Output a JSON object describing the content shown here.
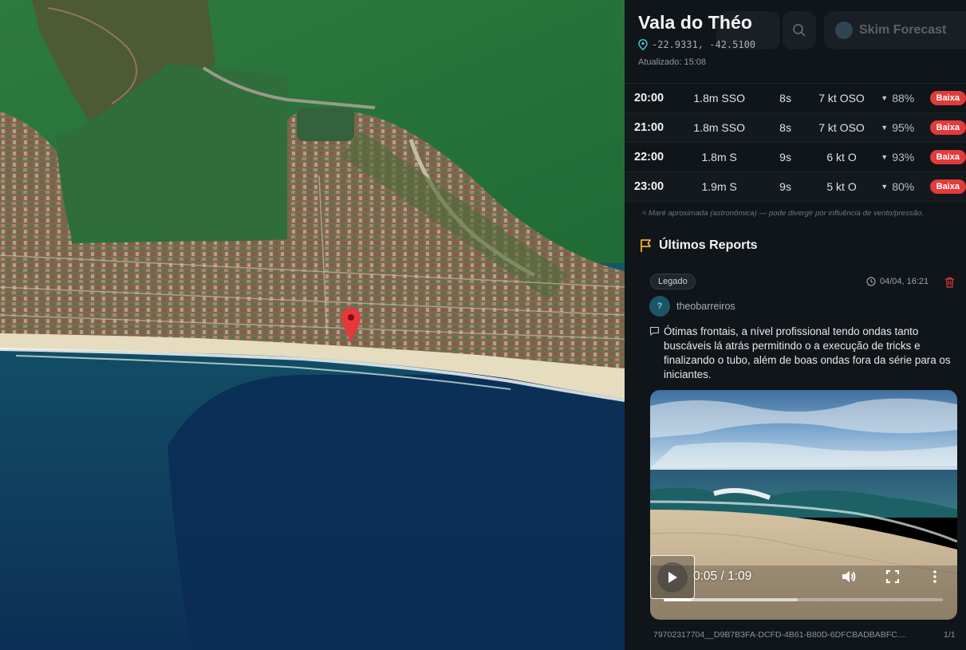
{
  "spot": {
    "name": "Vala do Théo",
    "coordinates": "-22.9331, -42.5100",
    "updated": "Atualizado: 15:08"
  },
  "header_bg": {
    "brand": "Skim Forecast"
  },
  "forecast": {
    "rows": [
      {
        "time": "20:00",
        "wave": "1.8m SSO",
        "period": "8s",
        "wind": "7 kt OSO",
        "tide": "88%",
        "rating": "Baixa"
      },
      {
        "time": "21:00",
        "wave": "1.8m SSO",
        "period": "8s",
        "wind": "7 kt OSO",
        "tide": "95%",
        "rating": "Baixa"
      },
      {
        "time": "22:00",
        "wave": "1.8m S",
        "period": "9s",
        "wind": "6 kt O",
        "tide": "93%",
        "rating": "Baixa"
      },
      {
        "time": "23:00",
        "wave": "1.9m S",
        "period": "9s",
        "wind": "5 kt O",
        "tide": "80%",
        "rating": "Baixa"
      }
    ],
    "tide_note": "≈ Maré aproximada (astronômica) — pode divergir por influência de vento/pressão."
  },
  "reports": {
    "title": "Últimos Reports",
    "items": [
      {
        "tag": "Legado",
        "date": "04/04, 16:21",
        "avatar_initial": "?",
        "user": "theobarreiros",
        "comment": "Ótimas frontais, a nível profissional tendo ondas tanto buscáveis lá atrás permitindo o a execução de tricks e finalizando o tubo, além de boas ondas fora da série para os iniciantes.",
        "video": {
          "time": "0:05 / 1:09",
          "played_fraction": 0.1,
          "buffered_fraction": 0.48
        },
        "filename": "79702317704__D9B7B3FA-DCFD-4B61-B80D-6DFCBADBABFC....",
        "counter": "1/1"
      }
    ]
  },
  "colors": {
    "accent": "#f0b429",
    "badge": "#e23b3b",
    "pin": "#e5383b",
    "panel_bg": "#11161a"
  },
  "icons": [
    "location-pin-icon",
    "flag-icon",
    "clock-icon",
    "trash-icon",
    "comment-icon",
    "play-icon",
    "volume-icon",
    "fullscreen-icon",
    "more-vert-icon",
    "search-icon"
  ]
}
